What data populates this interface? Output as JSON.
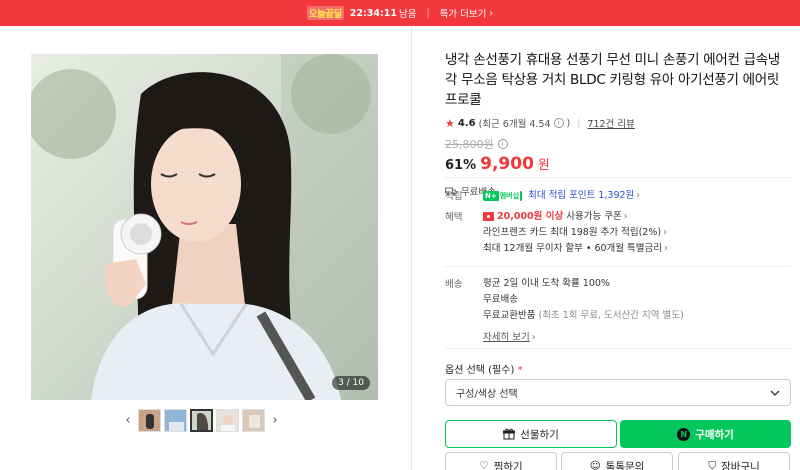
{
  "banner": {
    "brand": "오늘끝딜",
    "timer": "22:34:11",
    "remain": "남음",
    "more": "특가 더보기"
  },
  "gallery": {
    "counter": "3 / 10",
    "thumb_count": 5,
    "active_index": 2
  },
  "product": {
    "title": "냉각 손선풍기 휴대용 선풍기 무선 미니 손풍기 에어컨 급속냉각 무소음 탁상용 거치 BLDC 키링형 유아 아기선풍기 에어릿 프로쿨",
    "rating": "4.6",
    "rating_recent": "(최근 6개월 4.54",
    "rating_recent_close": ")",
    "review_count": "712건 리뷰",
    "original_price": "25,800원",
    "discount": "61%",
    "price": "9,900",
    "price_unit": "원",
    "shipping_badge": "무료배송"
  },
  "benefits": {
    "point_label": "적립",
    "npay_text": "N+",
    "npay_membership": "멤버십",
    "point_text": "최대 적립 포인트 1,392원",
    "benefit_label": "혜택",
    "coupon_amount": "20,000원 이상",
    "coupon_text": "사용가능 쿠폰",
    "card_text": "라인프렌즈 카드 최대 198원 추가 적립(2%)",
    "installment_text": "최대 12개월 무이자 할부 • 60개월 특별금리"
  },
  "delivery": {
    "label": "배송",
    "line1": "평균 2일 이내 도착 확률 100%",
    "line2": "무료배송",
    "line3_main": "무료교환반품",
    "line3_note": "(최초 1회 무료, 도서산간 지역 별도)",
    "detail": "자세히 보기"
  },
  "options": {
    "label": "옵션 선택 (필수)",
    "required_mark": "*",
    "select_value": "구성/색상 선택"
  },
  "actions": {
    "gift": "선물하기",
    "buy": "구매하기",
    "buy_logo": "N",
    "zzim": "찜하기",
    "talk": "톡톡문의",
    "cart": "장바구니"
  },
  "colors": {
    "accent_red": "#f2383b",
    "naver_green": "#03c75a"
  }
}
